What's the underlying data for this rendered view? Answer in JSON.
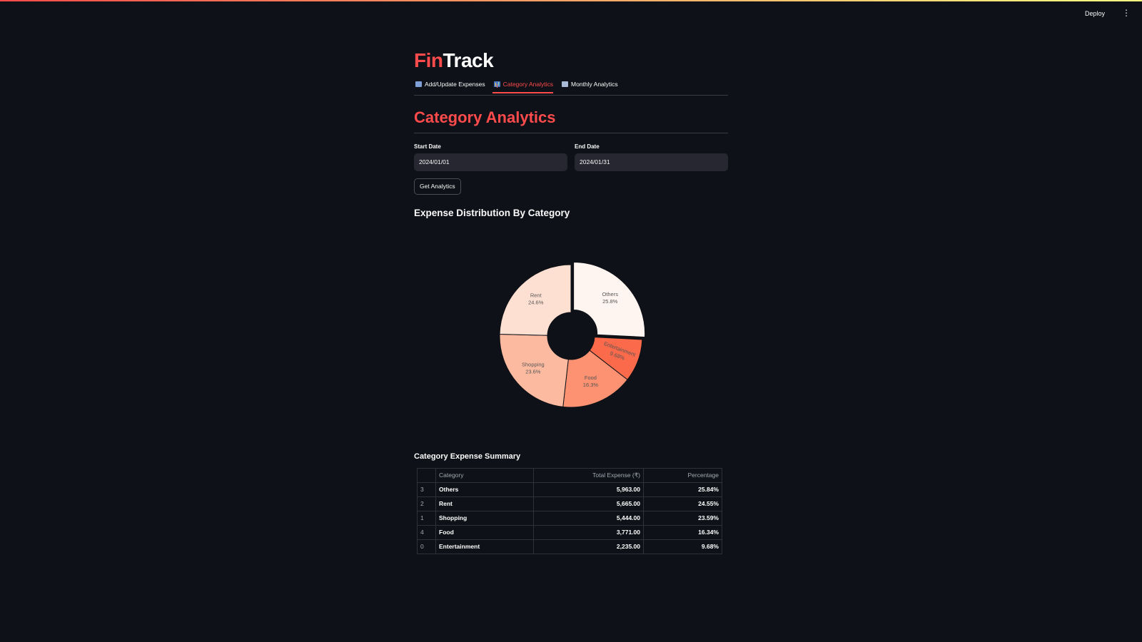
{
  "header": {
    "deploy_label": "Deploy",
    "menu_icon": "kebab-menu-icon"
  },
  "brand": {
    "part1": "Fin",
    "part2": "Track"
  },
  "tabs": [
    {
      "label": "Add/Update Expenses",
      "icon": "calendar-icon",
      "active": false
    },
    {
      "label": "Category Analytics",
      "icon": "bar-chart-icon",
      "active": true
    },
    {
      "label": "Monthly Analytics",
      "icon": "chart-icon",
      "active": false
    }
  ],
  "page": {
    "title": "Category Analytics",
    "start_label": "Start Date",
    "start_value": "2024/01/01",
    "end_label": "End Date",
    "end_value": "2024/01/31",
    "button_label": "Get Analytics",
    "chart_title": "Expense Distribution By Category",
    "table_title": "Category Expense Summary"
  },
  "colors": {
    "accent": "#ff4b4b",
    "background": "#0e1117"
  },
  "chart_data": {
    "type": "pie",
    "hole": 0.33,
    "categories": [
      "Others",
      "Entertainment",
      "Food",
      "Shopping",
      "Rent"
    ],
    "values": [
      25.8,
      9.68,
      16.3,
      23.6,
      24.6
    ],
    "slice_labels": [
      "Others\n25.8%",
      "Entertainment\n9.68%",
      "Food\n16.3%",
      "Shopping\n23.6%",
      "Rent\n24.6%"
    ],
    "colors": [
      "#fff5f0",
      "#fb6a4a",
      "#fc9272",
      "#fcbba1",
      "#fee0d2"
    ],
    "pulled": [
      "Others"
    ]
  },
  "table": {
    "columns": [
      "",
      "Category",
      "Total Expense (₹)",
      "Percentage"
    ],
    "rows": [
      [
        "3",
        "Others",
        "5,963.00",
        "25.84%"
      ],
      [
        "2",
        "Rent",
        "5,665.00",
        "24.55%"
      ],
      [
        "1",
        "Shopping",
        "5,444.00",
        "23.59%"
      ],
      [
        "4",
        "Food",
        "3,771.00",
        "16.34%"
      ],
      [
        "0",
        "Entertainment",
        "2,235.00",
        "9.68%"
      ]
    ]
  }
}
